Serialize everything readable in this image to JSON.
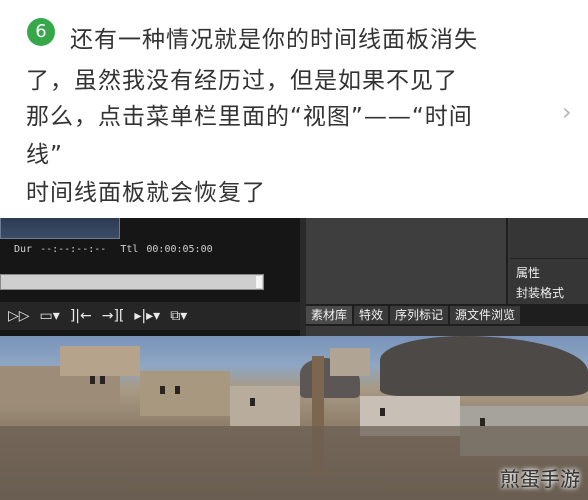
{
  "article": {
    "step_number": "6",
    "lines": [
      "还有一种情况就是你的时间线面板消失",
      "了，虽然我没有经历过，但是如果不见了",
      "那么，点击菜单栏里面的“视图”——“时间",
      "线”",
      "时间线面板就会恢复了"
    ],
    "next_icon": "chevron-right-icon"
  },
  "editor": {
    "timecode": {
      "dur_label": "Dur",
      "dur_value": "--:--:--:--",
      "ttl_label": "Ttl",
      "ttl_value": "00:00:05:00"
    },
    "transport_icons": [
      "fast-forward-icon",
      "monitor-icon",
      "set-in-icon",
      "set-out-icon",
      "split-icon",
      "snapshot-icon"
    ],
    "properties": {
      "attr_label": "属性",
      "format_label": "封装格式"
    },
    "tabs": [
      "素材库",
      "特效",
      "序列标记",
      "源文件浏览"
    ],
    "active_tab_index": 0
  },
  "watermark": "煎蛋手游",
  "colors": {
    "step_badge": "#37a84a",
    "editor_bg": "#2a2a2a",
    "text": "#333333"
  }
}
